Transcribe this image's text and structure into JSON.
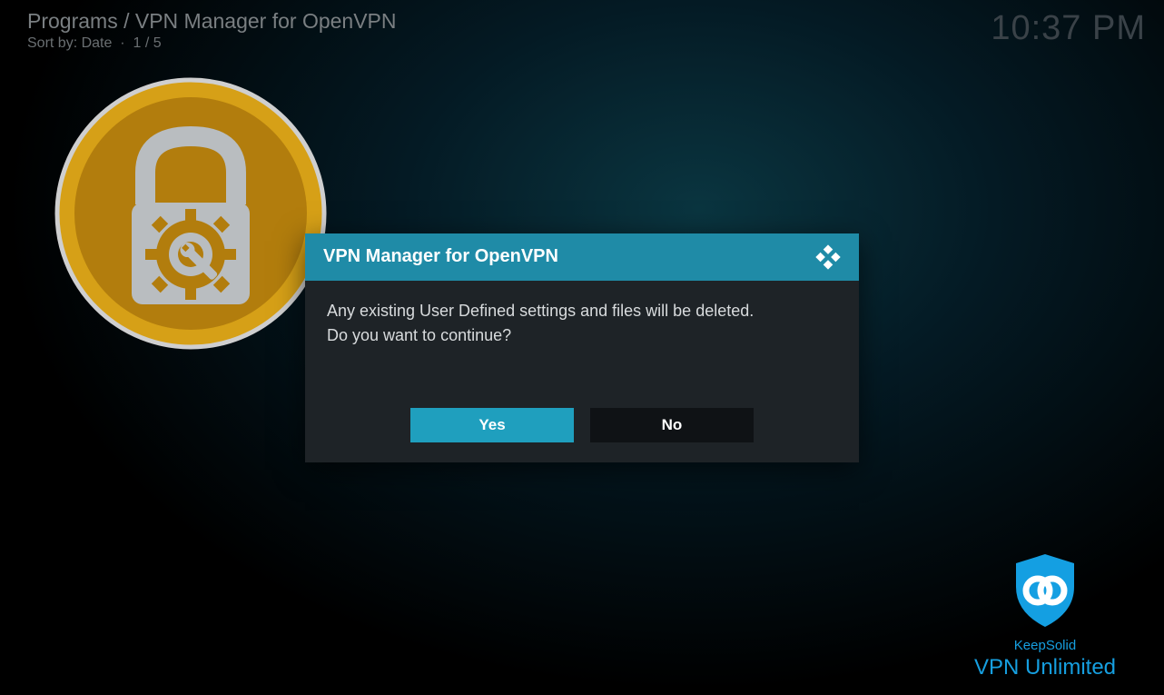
{
  "header": {
    "breadcrumb": "Programs / VPN Manager for OpenVPN",
    "sort_label": "Sort by: Date",
    "position": "1 / 5",
    "separator": "·"
  },
  "clock": {
    "time": "10:37 PM"
  },
  "dialog": {
    "title": "VPN Manager for OpenVPN",
    "message_line1": "Any existing User Defined settings and files will be deleted.",
    "message_line2": "Do you want to continue?",
    "yes_label": "Yes",
    "no_label": "No"
  },
  "watermark": {
    "brand": "KeepSolid",
    "product": "VPN Unlimited"
  },
  "colors": {
    "accent": "#1f9fbe",
    "dialog_bg": "#1e2327",
    "watermark": "#169fe0"
  }
}
